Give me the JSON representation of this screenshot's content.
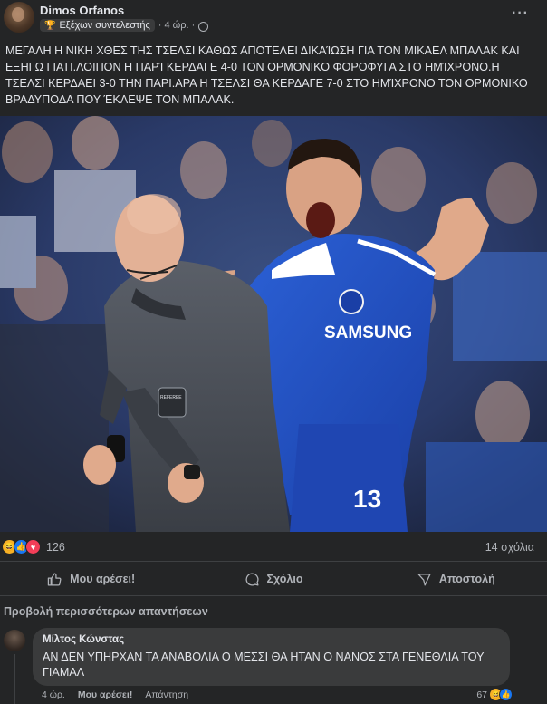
{
  "post": {
    "author": "Dimos Orfanos",
    "badge": "Εξέχων συντελεστής",
    "time": "· 4 ώρ. ·",
    "text": "ΜΕΓΑΛΗ Η ΝΙΚΗ ΧΘΕΣ ΤΗΣ ΤΣΕΛΣΙ ΚΑΘΩΣ ΑΠΟΤΕΛΕΙ ΔΙΚΑΊΩΣΗ ΓΙΑ ΤΟΝ ΜΙΚΑΕΛ ΜΠΑΛΑΚ ΚΑΙ\nΕΞΗΓΩ ΓΙΑΤΙ.ΛΟΙΠΟΝ Η ΠΑΡΊ ΚΕΡΔΑΓΕ 4-0 ΤΟΝ ΟΡΜΟΝΙΚΟ ΦΟΡΟΦΥΓΑ ΣΤΟ ΗΜΊΧΡΟΝΟ.Η\nΤΣΕΛΣΙ ΚΕΡΔΑΕΙ 3-0 ΤΗΝ ΠΑΡΙ.ΑΡΑ Η ΤΣΕΛΣΙ ΘΑ ΚΕΡΔΑΓΕ 7-0 ΣΤΟ ΗΜΊΧΡΟΝΟ ΤΟΝ ΟΡΜΟΝΙΚΟ\nΒΡΑΔΥΠΟΔΑ ΠΟΥ ΈΚΛΕΨΕ ΤΟΝ ΜΠΑΛΑΚ.",
    "photo": {
      "shirt_sponsor": "SAMSUNG",
      "shirt_number": "13",
      "patch_text": "REFEREE"
    },
    "reactions": {
      "count": "126",
      "comments": "14 σχόλια",
      "icons": [
        "haha-icon",
        "like-icon",
        "love-icon"
      ]
    },
    "actions": {
      "like": "Μου αρέσει!",
      "comment": "Σχόλιο",
      "share": "Αποστολή"
    }
  },
  "comments_section": {
    "more_replies": "Προβολή περισσότερων απαντήσεων",
    "comment": {
      "author": "Μίλτος Κώνστας",
      "text": "ΑΝ ΔΕΝ ΥΠΗΡΧΑΝ ΤΑ ΑΝΑΒΟΛΙΑ Ο ΜΕΣΣΙ ΘΑ ΗΤΑΝ Ο ΝΑΝΟΣ ΣΤΑ ΓΕΝΕΘΛΙΑ ΤΟΥ ΓΙΑΜΑΛ",
      "time": "4 ώρ.",
      "like": "Μου αρέσει!",
      "reply": "Απάντηση",
      "reaction_count": "67"
    }
  },
  "colors": {
    "background": "#242526",
    "text": "#e4e6eb",
    "secondary": "#b0b3b8",
    "like_blue": "#1877f2",
    "love_red": "#f33e58",
    "haha_yellow": "#f7b125",
    "chelsea_blue": "#1d4fc4",
    "referee_gray": "#4a4f57"
  }
}
